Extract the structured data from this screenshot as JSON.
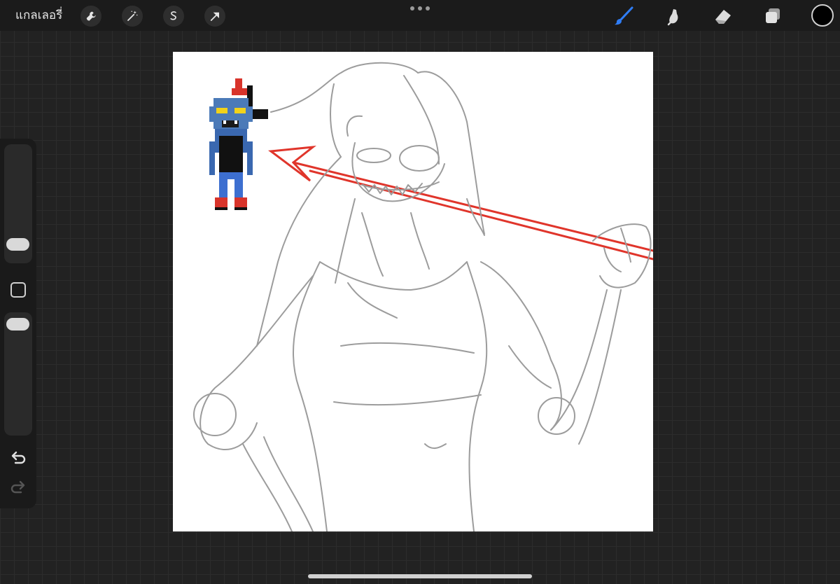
{
  "topbar": {
    "gallery_label": "แกลเลอรี่",
    "actions_icon": "wrench-icon",
    "adjustments_icon": "magic-wand-icon",
    "selection_icon": "selection-s-icon",
    "transform_icon": "transform-arrow-icon",
    "more_icon": "ellipsis-icon",
    "brush_icon": "brush-icon",
    "smudge_icon": "smudge-icon",
    "eraser_icon": "eraser-icon",
    "layers_icon": "layers-icon",
    "active_tool_color": "#2f7df6",
    "current_color": "#000000"
  },
  "sidebar": {
    "brush_size_icon": "brush-size-slider",
    "opacity_icon": "opacity-slider",
    "modify_icon": "square-modify-icon",
    "undo_icon": "undo-arrow-icon",
    "redo_icon": "redo-arrow-icon"
  },
  "canvas": {
    "background": "#ffffff",
    "sketch_color": "#8f8f8f",
    "spear_color": "#e0352b"
  }
}
